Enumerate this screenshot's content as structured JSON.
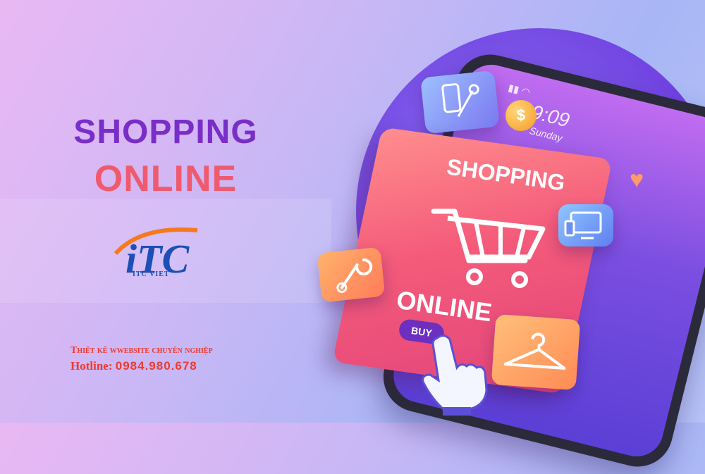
{
  "headline": {
    "line1": "SHOPPING",
    "line2": "ONLINE"
  },
  "logo": {
    "text": "ITC VIET"
  },
  "tagline": {
    "line1": "Thiết kế wwebsite chuyên  nghiệp",
    "hotline_label": "Hotline:",
    "hotline_number": "0984.980.678"
  },
  "phone": {
    "time": "09:09",
    "day": "Sunday"
  },
  "card": {
    "title": "SHOPPING",
    "subtitle": "ONLINE",
    "buy_label": "BUY"
  },
  "icons": [
    "phone-pen-icon",
    "coin-dollar-icon",
    "monitor-icon",
    "wrench-icon",
    "hanger-icon",
    "heart-icon",
    "cart-icon",
    "pointer-hand-icon"
  ],
  "colors": {
    "headline1": "#7a2ec8",
    "headline2": "#ef5a6e",
    "tagline": "#ee3a2f",
    "logo_blue": "#1d4fb6",
    "logo_orange": "#f47a20"
  }
}
